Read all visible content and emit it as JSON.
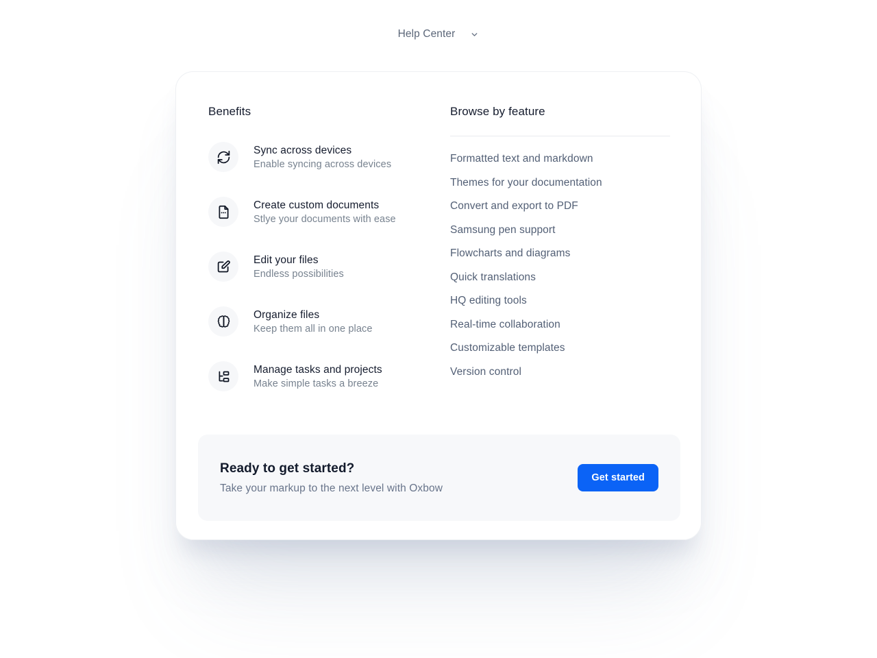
{
  "header": {
    "title": "Help Center",
    "chevron_icon": "chevron-down-icon"
  },
  "benefits_section": {
    "title": "Benefits",
    "items": [
      {
        "icon": "sync-icon",
        "title": "Sync across devices",
        "subtitle": "Enable syncing across devices"
      },
      {
        "icon": "file-text-icon",
        "title": "Create custom documents",
        "subtitle": "Stlye your documents with ease"
      },
      {
        "icon": "square-pen-icon",
        "title": "Edit your files",
        "subtitle": "Endless possibilities"
      },
      {
        "icon": "brain-icon",
        "title": "Organize files",
        "subtitle": "Keep them all in one place"
      },
      {
        "icon": "list-tree-icon",
        "title": "Manage tasks and projects",
        "subtitle": "Make simple tasks a breeze"
      }
    ]
  },
  "features_section": {
    "title": "Browse by feature",
    "links": [
      "Formatted text and markdown",
      "Themes for your documentation",
      "Convert and export to PDF",
      "Samsung pen support",
      "Flowcharts and diagrams",
      "Quick translations",
      "HQ editing tools",
      "Real-time collaboration",
      "Customizable templates",
      "Version control"
    ]
  },
  "cta": {
    "title": "Ready to get started?",
    "subtitle": "Take your markup to the next level with Oxbow",
    "button_label": "Get started"
  },
  "colors": {
    "accent": "#0b63f6",
    "heading": "#141b2d",
    "muted": "#77828f",
    "link": "#525f75",
    "icon_circle": "#f6f7f9",
    "cta_background": "#f7f8fa",
    "divider": "#e9eaee"
  }
}
